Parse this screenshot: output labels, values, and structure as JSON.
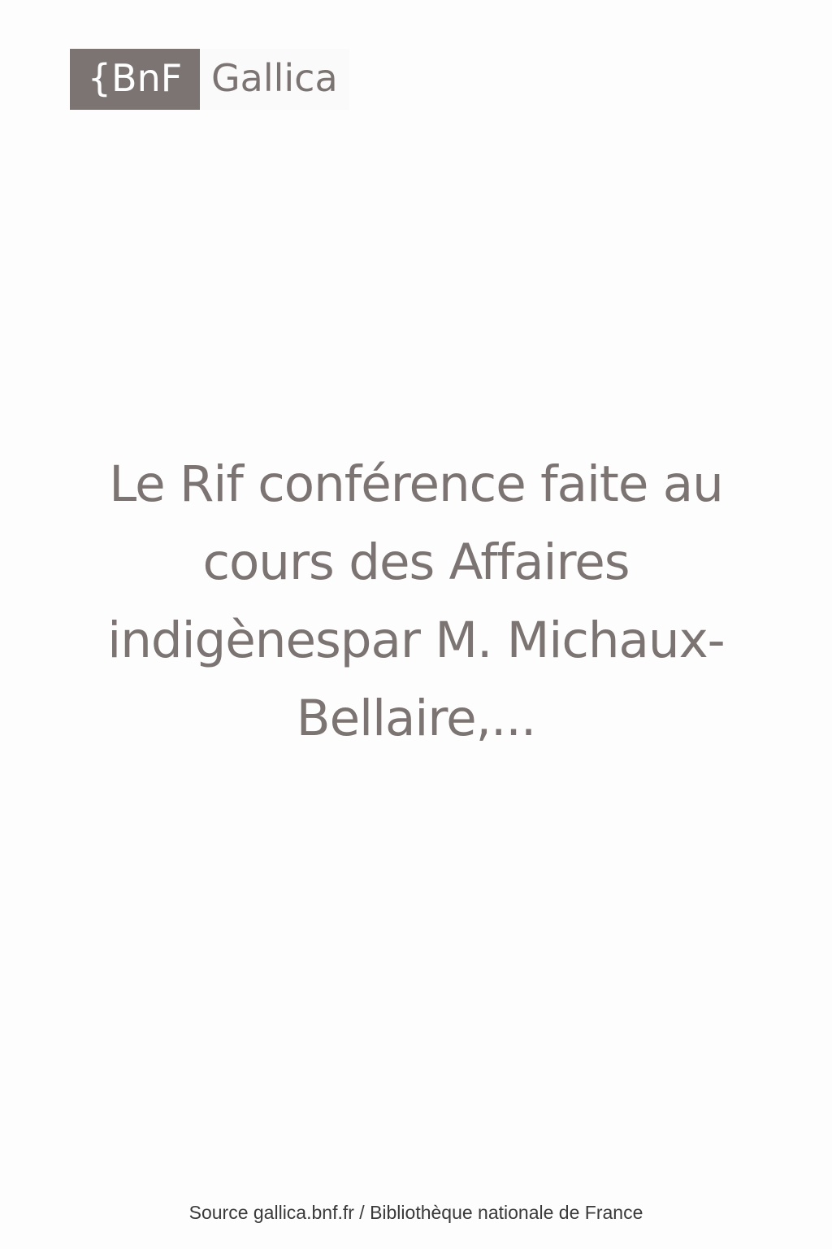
{
  "logo": {
    "brand": "{BnF",
    "name": "Gallica"
  },
  "document": {
    "title": "Le Rif conférence faite au cours des Affaires indigènespar M. Michaux-Bellaire,..."
  },
  "footer": {
    "source": "Source gallica.bnf.fr / Bibliothèque nationale de France"
  },
  "colors": {
    "brand_gray": "#7b7472",
    "background": "#fdfdfd",
    "footer_text": "#3a3a3a"
  }
}
